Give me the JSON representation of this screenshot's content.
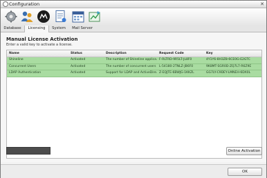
{
  "window": {
    "title": "Configuration"
  },
  "toolbar": {
    "tabs": [
      {
        "label": "Database",
        "icon": "database-gear-icon"
      },
      {
        "label": "Licensing",
        "icon": "users-icon"
      },
      {
        "label": "System",
        "icon": "system-logo-icon"
      },
      {
        "label": "Mail Server",
        "icon": "mail-document-icon"
      }
    ],
    "extra_icons": [
      "calendar-icon",
      "chart-icon"
    ]
  },
  "page": {
    "heading": "Manual License Activation",
    "subtext": "Enter a valid key to activate a license."
  },
  "table": {
    "columns": [
      "Name",
      "Status",
      "Description",
      "Request Code",
      "Key"
    ],
    "rows": [
      {
        "name": "Shineline",
        "status": "Activated",
        "description": "The number of Shineline applica...",
        "request_code": "F-RLTRD-9R5LT-JL8F0",
        "key": "4Y1Y6-8H3Z8-6CE0G-E2GTC"
      },
      {
        "name": "Concurrent Users",
        "status": "Activated",
        "description": "The number of concurrent users ...",
        "request_code": "L-54180-2TNLZ-JB6F0",
        "key": "9K8MT-SGR0D-ZQ7L7-R6Z9E"
      },
      {
        "name": "LDAP Authentication",
        "status": "Activated",
        "description": "Support for LDAP and ActiveDire...",
        "request_code": "Z-EQJTE-6BWJG-1KKZL",
        "key": "GG7LY-C9DEY-LMNEH-6DX0L"
      }
    ]
  },
  "buttons": {
    "online_activation": "Online Activation",
    "ok": "OK"
  },
  "colors": {
    "row_activated": "#a9dca1",
    "progress": "#4d4d4d"
  }
}
